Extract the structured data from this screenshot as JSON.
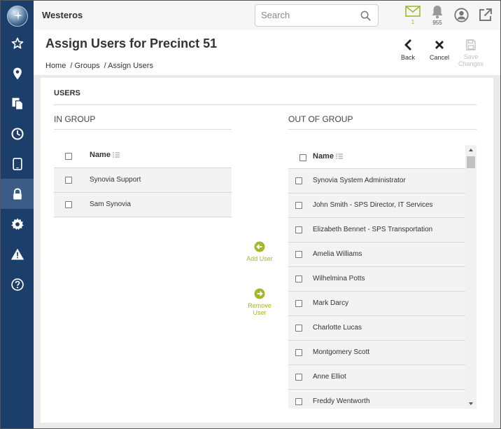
{
  "app": {
    "brand": "Westeros"
  },
  "search": {
    "placeholder": "Search"
  },
  "notifications": {
    "messages_count": "1",
    "alerts_count": "955"
  },
  "page": {
    "title": "Assign Users for Precinct 51",
    "breadcrumb": [
      "Home",
      "/ Groups",
      "/ Assign Users"
    ]
  },
  "actions": {
    "back": "Back",
    "cancel": "Cancel",
    "save": "Save Changes"
  },
  "users_section": {
    "title": "USERS"
  },
  "in_group": {
    "title": "IN GROUP",
    "column": "Name",
    "rows": [
      "Synovia Support",
      "Sam Synovia"
    ]
  },
  "out_of_group": {
    "title": "OUT OF GROUP",
    "column": "Name",
    "rows": [
      "Synovia System Administrator",
      "John Smith - SPS Director, IT Services",
      "Elizabeth Bennet - SPS Transportation",
      "Amelia Williams",
      "Wilhelmina Potts",
      "Mark Darcy",
      "Charlotte Lucas",
      "Montgomery Scott",
      "Anne Elliot",
      "Freddy Wentworth"
    ]
  },
  "move": {
    "add": "Add User",
    "remove": "Remove User"
  },
  "colors": {
    "sidebar": "#1c3e6b",
    "sidebar_active": "#3b5c86",
    "accent": "#a6b52a"
  }
}
